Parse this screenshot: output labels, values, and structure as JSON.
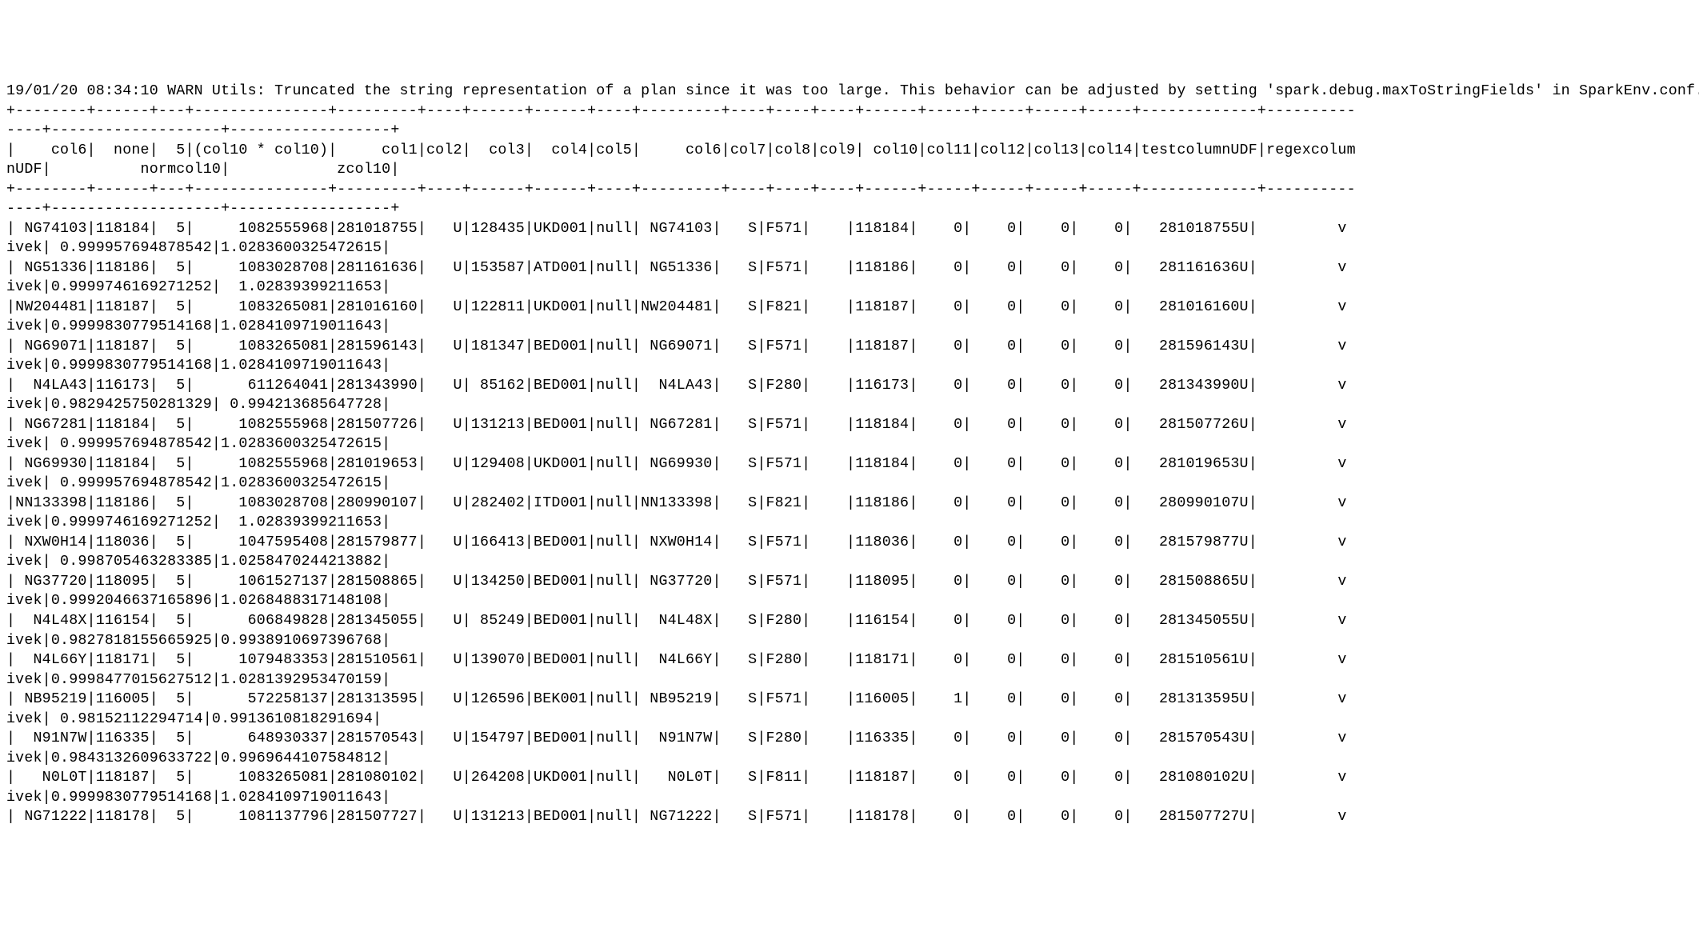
{
  "log_line": "19/01/20 08:34:10 WARN Utils: Truncated the string representation of a plan since it was too large. This behavior can be adjusted by setting 'spark.debug.maxToStringFields' in SparkEnv.conf.",
  "header_segments": {
    "line1": "|    col6|  none|  5|(col10 * col10)|     col1|col2|  col3|  col4|col5|     col6|col7|col8|col9| col10|col11|col12|col13|col14|testcolumnUDF|regexcolum",
    "line2": "nUDF|          normcol10|            zcol10|"
  },
  "separator_top": "+--------+------+---+---------------+---------+----+------+------+----+---------+----+----+----+------+-----+-----+-----+-----+-------------+----------",
  "separator_cont": "----+-------------------+------------------+",
  "rows": [
    {
      "l1": "| NG74103|118184|  5|     1082555968|281018755|   U|128435|UKD001|null| NG74103|   S|F571|    |118184|    0|    0|    0|    0|   281018755U|         v",
      "l2": "ivek| 0.999957694878542|1.0283600325472615|"
    },
    {
      "l1": "| NG51336|118186|  5|     1083028708|281161636|   U|153587|ATD001|null| NG51336|   S|F571|    |118186|    0|    0|    0|    0|   281161636U|         v",
      "l2": "ivek|0.9999746169271252|  1.02839399211653|"
    },
    {
      "l1": "|NW204481|118187|  5|     1083265081|281016160|   U|122811|UKD001|null|NW204481|   S|F821|    |118187|    0|    0|    0|    0|   281016160U|         v",
      "l2": "ivek|0.9999830779514168|1.0284109719011643|"
    },
    {
      "l1": "| NG69071|118187|  5|     1083265081|281596143|   U|181347|BED001|null| NG69071|   S|F571|    |118187|    0|    0|    0|    0|   281596143U|         v",
      "l2": "ivek|0.9999830779514168|1.0284109719011643|"
    },
    {
      "l1": "|  N4LA43|116173|  5|      611264041|281343990|   U| 85162|BED001|null|  N4LA43|   S|F280|    |116173|    0|    0|    0|    0|   281343990U|         v",
      "l2": "ivek|0.9829425750281329| 0.994213685647728|"
    },
    {
      "l1": "| NG67281|118184|  5|     1082555968|281507726|   U|131213|BED001|null| NG67281|   S|F571|    |118184|    0|    0|    0|    0|   281507726U|         v",
      "l2": "ivek| 0.999957694878542|1.0283600325472615|"
    },
    {
      "l1": "| NG69930|118184|  5|     1082555968|281019653|   U|129408|UKD001|null| NG69930|   S|F571|    |118184|    0|    0|    0|    0|   281019653U|         v",
      "l2": "ivek| 0.999957694878542|1.0283600325472615|"
    },
    {
      "l1": "|NN133398|118186|  5|     1083028708|280990107|   U|282402|ITD001|null|NN133398|   S|F821|    |118186|    0|    0|    0|    0|   280990107U|         v",
      "l2": "ivek|0.9999746169271252|  1.02839399211653|"
    },
    {
      "l1": "| NXW0H14|118036|  5|     1047595408|281579877|   U|166413|BED001|null| NXW0H14|   S|F571|    |118036|    0|    0|    0|    0|   281579877U|         v",
      "l2": "ivek| 0.998705463283385|1.0258470244213882|"
    },
    {
      "l1": "| NG37720|118095|  5|     1061527137|281508865|   U|134250|BED001|null| NG37720|   S|F571|    |118095|    0|    0|    0|    0|   281508865U|         v",
      "l2": "ivek|0.9992046637165896|1.0268488317148108|"
    },
    {
      "l1": "|  N4L48X|116154|  5|      606849828|281345055|   U| 85249|BED001|null|  N4L48X|   S|F280|    |116154|    0|    0|    0|    0|   281345055U|         v",
      "l2": "ivek|0.9827818155665925|0.9938910697396768|"
    },
    {
      "l1": "|  N4L66Y|118171|  5|     1079483353|281510561|   U|139070|BED001|null|  N4L66Y|   S|F280|    |118171|    0|    0|    0|    0|   281510561U|         v",
      "l2": "ivek|0.9998477015627512|1.0281392953470159|"
    },
    {
      "l1": "| NB95219|116005|  5|      572258137|281313595|   U|126596|BEK001|null| NB95219|   S|F571|    |116005|    1|    0|    0|    0|   281313595U|         v",
      "l2": "ivek| 0.98152112294714|0.9913610818291694|"
    },
    {
      "l1": "|  N91N7W|116335|  5|      648930337|281570543|   U|154797|BED001|null|  N91N7W|   S|F280|    |116335|    0|    0|    0|    0|   281570543U|         v",
      "l2": "ivek|0.9843132609633722|0.9969644107584812|"
    },
    {
      "l1": "|   N0L0T|118187|  5|     1083265081|281080102|   U|264208|UKD001|null|   N0L0T|   S|F811|    |118187|    0|    0|    0|    0|   281080102U|         v",
      "l2": "ivek|0.9999830779514168|1.0284109719011643|"
    },
    {
      "l1": "| NG71222|118178|  5|     1081137796|281507727|   U|131213|BED001|null| NG71222|   S|F571|    |118178|    0|    0|    0|    0|   281507727U|         v",
      "l2": ""
    }
  ]
}
